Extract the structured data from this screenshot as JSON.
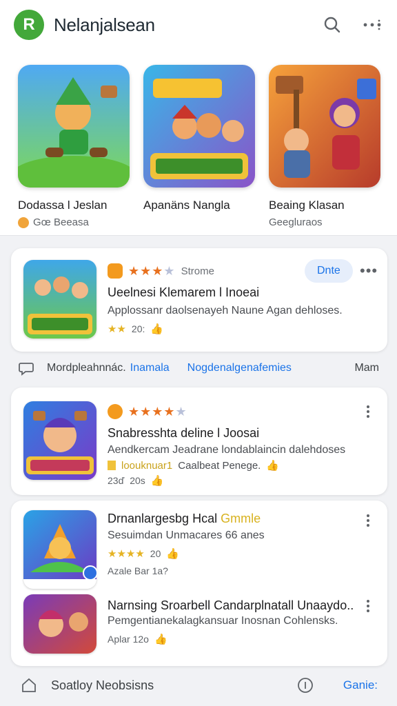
{
  "header": {
    "logo_letter": "R",
    "title": "Nelanjalsean",
    "search_icon": "search-icon",
    "more_icon": "more-horizontal-icon"
  },
  "featured": [
    {
      "title": "Dodassa l Jeslan",
      "subtitle": "Gœ Beeasa"
    },
    {
      "title": "Apanäns Nangla",
      "subtitle": ""
    },
    {
      "title": "Beaing Klasan",
      "subtitle": "Geegluraos"
    }
  ],
  "feed": [
    {
      "meta": "Strome",
      "action_label": "Dnte",
      "title": "Ueelnesi Klemarem l Inoeai",
      "desc": "Applossanr daolsenayeh Naune Agan dehloses.",
      "foot": "20:",
      "stars": 3
    },
    {
      "title": "Snabresshta deline l Joosai",
      "desc": "Aendkercam Jeadrane londablaincin dalehdoses",
      "desc2_tag": "loouknuar1",
      "desc2_rest": "Caalbeat Penege.",
      "foot_left": "23ď",
      "foot_right": "20s",
      "stars": 4
    },
    {
      "title": "Drnanlargesbg Hcal",
      "title_accent": "Gmm",
      "title_tail": "le",
      "desc": "Sesuimdan Unmacares 66 anes",
      "foot": "20",
      "foot2": "Azale  Bar 1a?",
      "stars": 4
    },
    {
      "title": "Narnsing Sroarbell Candarplnatall Unaaydo..",
      "desc": "Pemgentianekalagkansuar Inosnan Cohlensks.",
      "foot": "Aplar  12o"
    }
  ],
  "chips": {
    "left": "Mordpleahnnác.",
    "link1": "Inamala",
    "link2": "Nogdenalgenafemies",
    "right": "Mam"
  },
  "bottom": {
    "label": "Soatloy Neobsisns",
    "right_link": "Ganie:"
  },
  "colors": {
    "accent": "#1a73e8",
    "logo": "#43a83a",
    "star": "#e8711f"
  }
}
